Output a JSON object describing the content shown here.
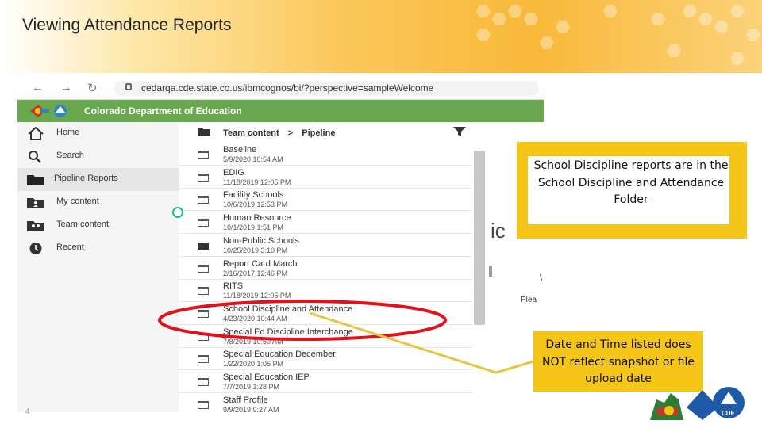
{
  "slide": {
    "title": "Viewing Attendance Reports",
    "page_number": "4"
  },
  "browser": {
    "url": "cedarqa.cde.state.co.us/ibmcognos/bi/?perspective=sampleWelcome",
    "brand": "Colorado Department of Education"
  },
  "sidebar": {
    "items": [
      {
        "label": "Home",
        "icon": "home-icon"
      },
      {
        "label": "Search",
        "icon": "search-icon"
      },
      {
        "label": "Pipeline Reports",
        "icon": "folder-icon"
      },
      {
        "label": "My content",
        "icon": "my-content-icon"
      },
      {
        "label": "Team content",
        "icon": "team-content-icon"
      },
      {
        "label": "Recent",
        "icon": "clock-icon"
      }
    ]
  },
  "content": {
    "path_root": "Team content",
    "path_separator": ">",
    "path_current": "Pipeline",
    "rows": [
      {
        "name": "Baseline",
        "date": "5/9/2020 10:54 AM",
        "icon": "report-icon"
      },
      {
        "name": "EDIG",
        "date": "11/18/2019 12:05 PM",
        "icon": "report-icon"
      },
      {
        "name": "Facility Schools",
        "date": "10/6/2019 12:53 PM",
        "icon": "report-icon"
      },
      {
        "name": "Human Resource",
        "date": "10/1/2019 1:51 PM",
        "icon": "report-icon"
      },
      {
        "name": "Non-Public Schools",
        "date": "10/25/2019 3:10 PM",
        "icon": "folder-icon"
      },
      {
        "name": "Report Card March",
        "date": "2/16/2017 12:46 PM",
        "icon": "report-icon"
      },
      {
        "name": "RITS",
        "date": "11/18/2019 12:05 PM",
        "icon": "report-icon"
      },
      {
        "name": "School Discipline and Attendance",
        "date": "4/23/2020 10:44 AM",
        "icon": "report-icon"
      },
      {
        "name": "Special Ed Discipline Interchange",
        "date": "7/8/2019 10:50 AM",
        "icon": "report-icon"
      },
      {
        "name": "Special Education December",
        "date": "1/22/2020 1:05 PM",
        "icon": "report-icon"
      },
      {
        "name": "Special Education IEP",
        "date": "7/7/2019 1:28 PM",
        "icon": "report-icon"
      },
      {
        "name": "Staff Profile",
        "date": "9/9/2019 9:27 AM",
        "icon": "report-icon"
      }
    ],
    "partial_text": "ic",
    "partial_plea": "Plea",
    "partial_mark": "\\"
  },
  "callouts": {
    "discipline_folder": "School Discipline reports are in the School Discipline and Attendance Folder",
    "date_time_note": "Date and Time listed does NOT reflect snapshot or file upload date"
  },
  "colors": {
    "banner": "#f9b93a",
    "callout": "#f5c518",
    "highlight_ellipse": "#e0121b",
    "connector": "#e8c440",
    "brand_green": "#6aa84f"
  }
}
